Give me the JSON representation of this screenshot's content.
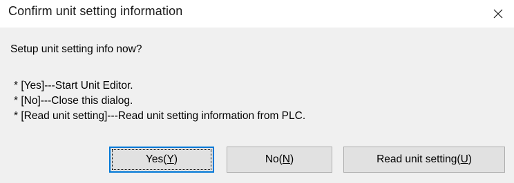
{
  "dialog": {
    "title": "Confirm unit setting information",
    "close_icon": "close-icon"
  },
  "message": {
    "question": "Setup unit setting info now?",
    "lines": [
      "* [Yes]---Start Unit Editor.",
      "* [No]---Close this dialog.",
      "* [Read unit setting]---Read unit setting information from PLC."
    ]
  },
  "buttons": {
    "yes": {
      "text": "Yes(",
      "mnemonic": "Y",
      "suffix": ")"
    },
    "no": {
      "text": "No(",
      "mnemonic": "N",
      "suffix": ")"
    },
    "read": {
      "text": "Read unit setting(",
      "mnemonic": "U",
      "suffix": ")"
    }
  },
  "colors": {
    "focus_border": "#0078d7",
    "button_face": "#e1e1e1",
    "content_bg": "#f0f0f0"
  }
}
